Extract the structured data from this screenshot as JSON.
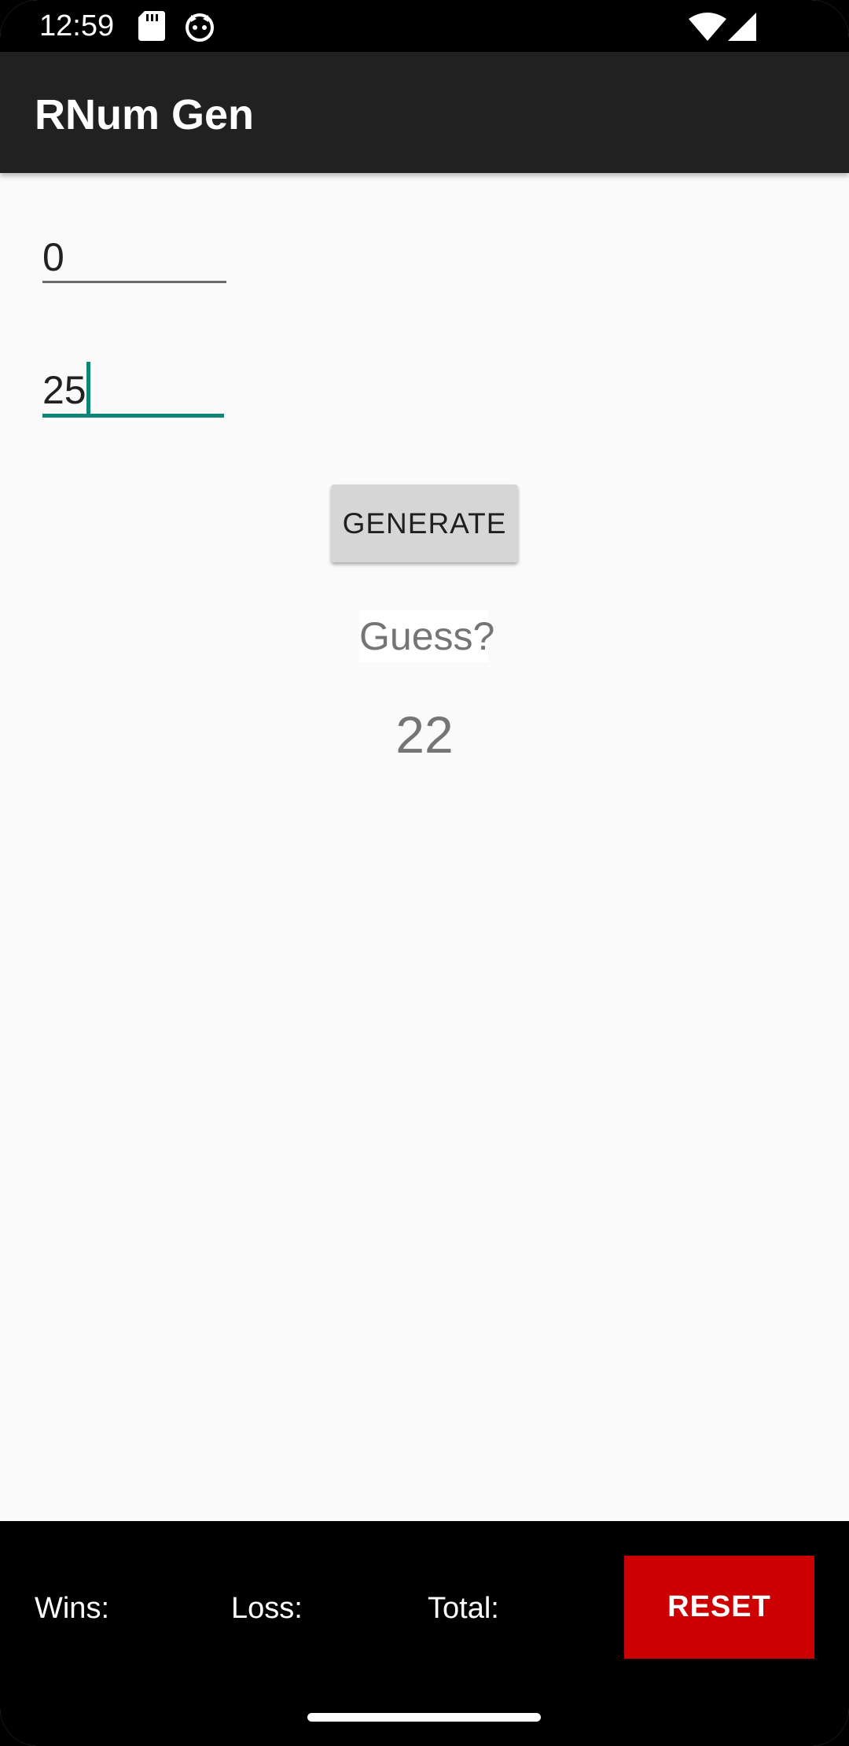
{
  "status_bar": {
    "time": "12:59",
    "icons": [
      "sd-card-icon",
      "cat-notification-icon",
      "wifi-icon",
      "cellular-signal-icon"
    ]
  },
  "app_bar": {
    "title": "RNum Gen"
  },
  "main": {
    "min_field": {
      "value": "0"
    },
    "max_field": {
      "value": "25"
    },
    "generate_label": "GENERATE",
    "guess_label": "Guess?",
    "result": "22"
  },
  "bottom_bar": {
    "wins_label": "Wins:",
    "loss_label": "Loss:",
    "total_label": "Total:",
    "reset_label": "RESET"
  },
  "colors": {
    "app_bar": "#212121",
    "accent": "#0f8575",
    "reset_button": "#cc0000",
    "background": "#fafafa"
  }
}
